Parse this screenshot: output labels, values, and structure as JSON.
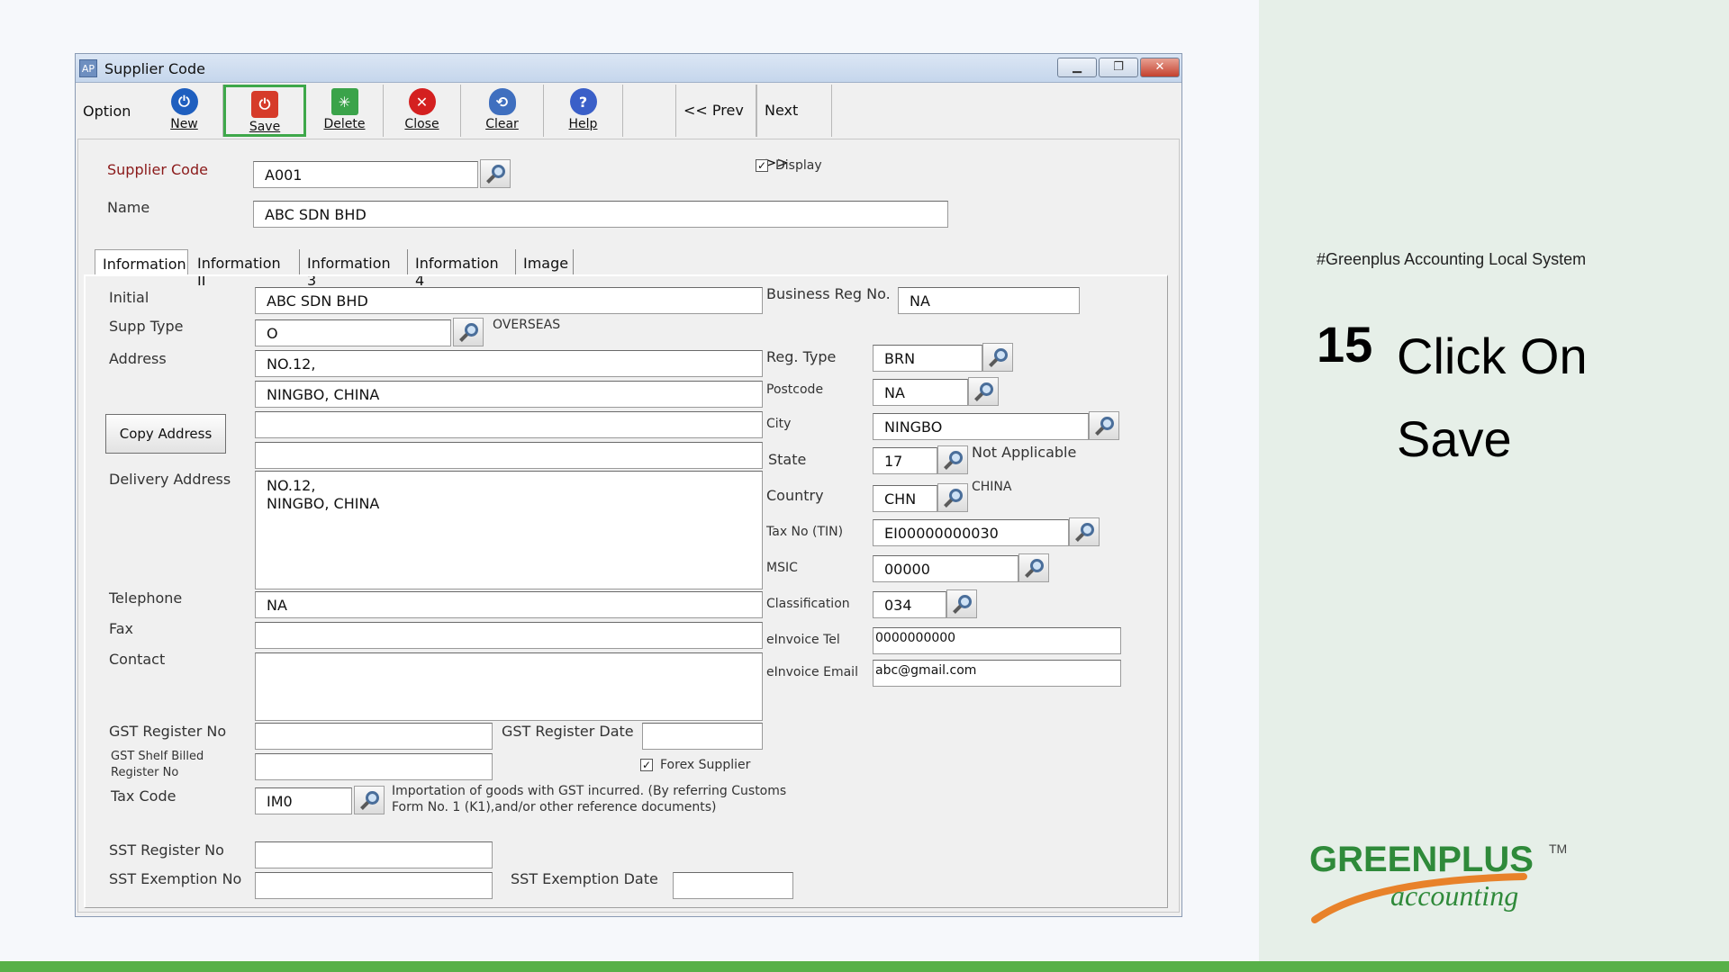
{
  "window": {
    "title": "Supplier Code",
    "app_icon": "AP",
    "controls": [
      "minimize",
      "restore",
      "close"
    ]
  },
  "toolbar": {
    "option_label": "Option",
    "buttons": [
      {
        "label": "New",
        "icon": "power-icon",
        "color": "#1f5fbf"
      },
      {
        "label": "Save",
        "icon": "save-icon",
        "color": "#d63b2a"
      },
      {
        "label": "Delete",
        "icon": "delete-icon",
        "color": "#3ba34a"
      },
      {
        "label": "Close",
        "icon": "close-icon",
        "color": "#d42020"
      },
      {
        "label": "Clear",
        "icon": "clear-icon",
        "color": "#3f6fbf"
      },
      {
        "label": "Help",
        "icon": "help-icon",
        "color": "#3a5fc8"
      }
    ],
    "prev_label": "<<  Prev",
    "next_label": "Next  >>",
    "highlighted": "Save"
  },
  "header_fields": {
    "supplier_code_label": "Supplier Code",
    "supplier_code_value": "A001",
    "display_label": "Display",
    "display_checked": true,
    "name_label": "Name",
    "name_value": "ABC SDN BHD"
  },
  "tabs": [
    "Information",
    "Information II",
    "Information 3",
    "Information 4",
    "Image"
  ],
  "selected_tab": "Information",
  "info": {
    "initial_label": "Initial",
    "initial_value": "ABC SDN BHD",
    "supp_type_label": "Supp Type",
    "supp_type_value": "O",
    "supp_type_desc": "OVERSEAS",
    "address_label": "Address",
    "address_lines": [
      "NO.12,",
      "NINGBO, CHINA",
      "",
      ""
    ],
    "copy_address_label": "Copy Address",
    "delivery_label": "Delivery Address",
    "delivery_value": "NO.12,\nNINGBO, CHINA",
    "telephone_label": "Telephone",
    "telephone_value": "NA",
    "fax_label": "Fax",
    "fax_value": "",
    "contact_label": "Contact",
    "contact_value": "",
    "gst_reg_no_label": "GST Register No",
    "gst_reg_date_label": "GST Register Date",
    "gst_shelf_label_1": "GST Shelf Billed",
    "gst_shelf_label_2": "Register No",
    "forex_label": "Forex Supplier",
    "forex_checked": true,
    "tax_code_label": "Tax Code",
    "tax_code_value": "IM0",
    "tax_code_desc_1": "Importation of goods with GST incurred. (By referring Customs",
    "tax_code_desc_2": "Form No. 1 (K1),and/or other reference documents)",
    "sst_reg_label": "SST Register No",
    "sst_exempt_label": "SST Exemption No",
    "sst_exempt_date_label": "SST Exemption Date"
  },
  "right_fields": {
    "brn_label": "Business Reg No.",
    "brn_value": "NA",
    "reg_type_label": "Reg. Type",
    "reg_type_value": "BRN",
    "postcode_label": "Postcode",
    "postcode_value": "NA",
    "city_label": "City",
    "city_value": "NINGBO",
    "state_label": "State",
    "state_value": "17",
    "state_desc": "Not Applicable",
    "country_label": "Country",
    "country_value": "CHN",
    "country_desc": "CHINA",
    "tin_label": "Tax No (TIN)",
    "tin_value": "EI00000000030",
    "msic_label": "MSIC",
    "msic_value": "00000",
    "classification_label": "Classification",
    "classification_value": "034",
    "einv_tel_label": "eInvoice Tel",
    "einv_tel_value": "0000000000",
    "einv_email_label": "eInvoice Email",
    "einv_email_value": "abc@gmail.com"
  },
  "slide": {
    "hashtag": "#Greenplus Accounting Local System",
    "step_number": "15",
    "step_text": "Click On Save",
    "logo_text_1": "GREENPLUS",
    "logo_tm": "TM",
    "logo_text_2": "accounting",
    "brand_green": "#2f8a3a",
    "brand_orange": "#e8822a"
  }
}
